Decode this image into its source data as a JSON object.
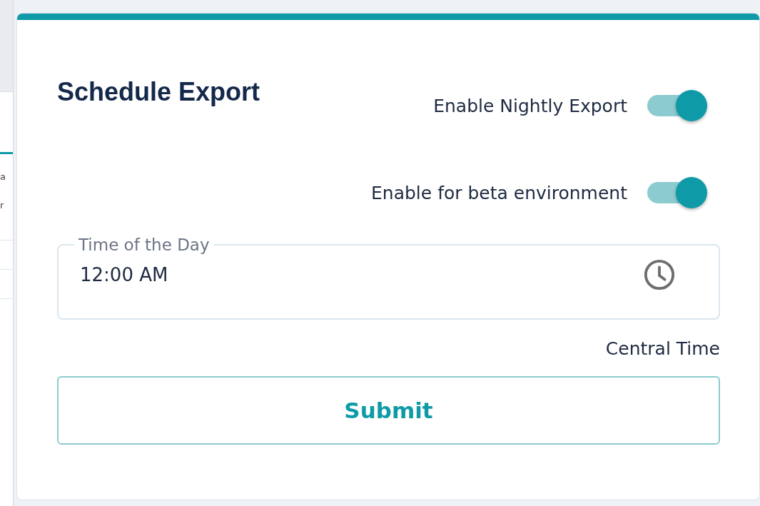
{
  "background_page": {
    "fragments": [
      "a",
      "r"
    ]
  },
  "dialog": {
    "title": "Schedule Export",
    "toggles": [
      {
        "label": "Enable Nightly Export",
        "on": true
      },
      {
        "label": "Enable for beta environment",
        "on": true
      }
    ],
    "time_field": {
      "label": "Time of the Day",
      "value": "12:00 AM"
    },
    "timezone": "Central Time",
    "submit_button": "Submit"
  }
}
